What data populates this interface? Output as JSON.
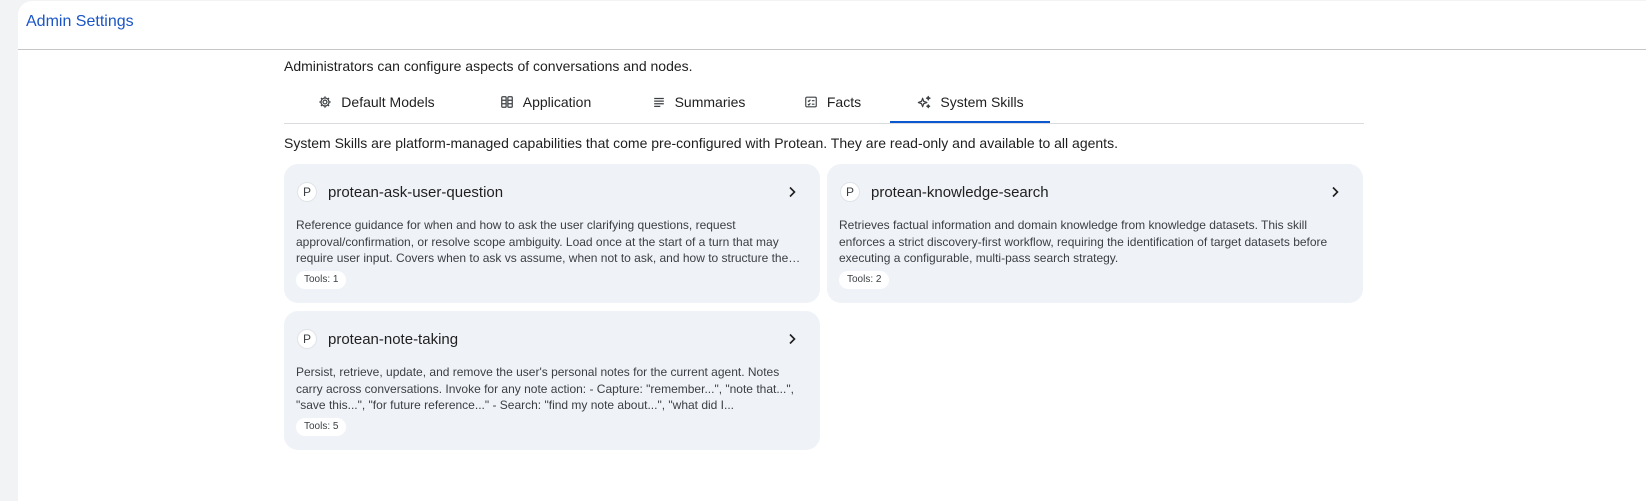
{
  "app": {
    "title": "Admin Settings"
  },
  "intro": "Administrators can configure aspects of conversations and nodes.",
  "tabs": [
    {
      "label": "Default Models",
      "icon": "model-gear-icon",
      "active": false
    },
    {
      "label": "Application",
      "icon": "application-grid-icon",
      "active": false
    },
    {
      "label": "Summaries",
      "icon": "summaries-lines-icon",
      "active": false
    },
    {
      "label": "Facts",
      "icon": "facts-checklist-icon",
      "active": false
    },
    {
      "label": "System Skills",
      "icon": "sparkle-icon",
      "active": true
    }
  ],
  "section_description": "System Skills are platform-managed capabilities that come pre-configured with Protean. They are read-only and available to all agents.",
  "skills": [
    {
      "avatar": "P",
      "name": "protean-ask-user-question",
      "description": "Reference guidance for when and how to ask the user clarifying questions, request approval/confirmation, or resolve scope ambiguity. Load once at the start of a turn that may require user input. Covers when to ask vs assume, when not to ask, and how to structure the question.",
      "tools": "Tools: 1"
    },
    {
      "avatar": "P",
      "name": "protean-knowledge-search",
      "description": "Retrieves factual information and domain knowledge from knowledge datasets. This skill enforces a strict discovery-first workflow, requiring the identification of target datasets before executing a configurable, multi-pass search strategy.",
      "tools": "Tools: 2"
    },
    {
      "avatar": "P",
      "name": "protean-note-taking",
      "description": "Persist, retrieve, update, and remove the user's personal notes for the current agent. Notes carry across conversations. Invoke for any note action: - Capture: \"remember...\", \"note that...\", \"save this...\", \"for future reference...\" - Search: \"find my note about...\", \"what did I...",
      "tools": "Tools: 5"
    }
  ],
  "colors": {
    "accent": "#0b57d0",
    "title_link": "#1a55c7",
    "card_bg": "#eff2f7",
    "page_bg": "#ffffff"
  }
}
